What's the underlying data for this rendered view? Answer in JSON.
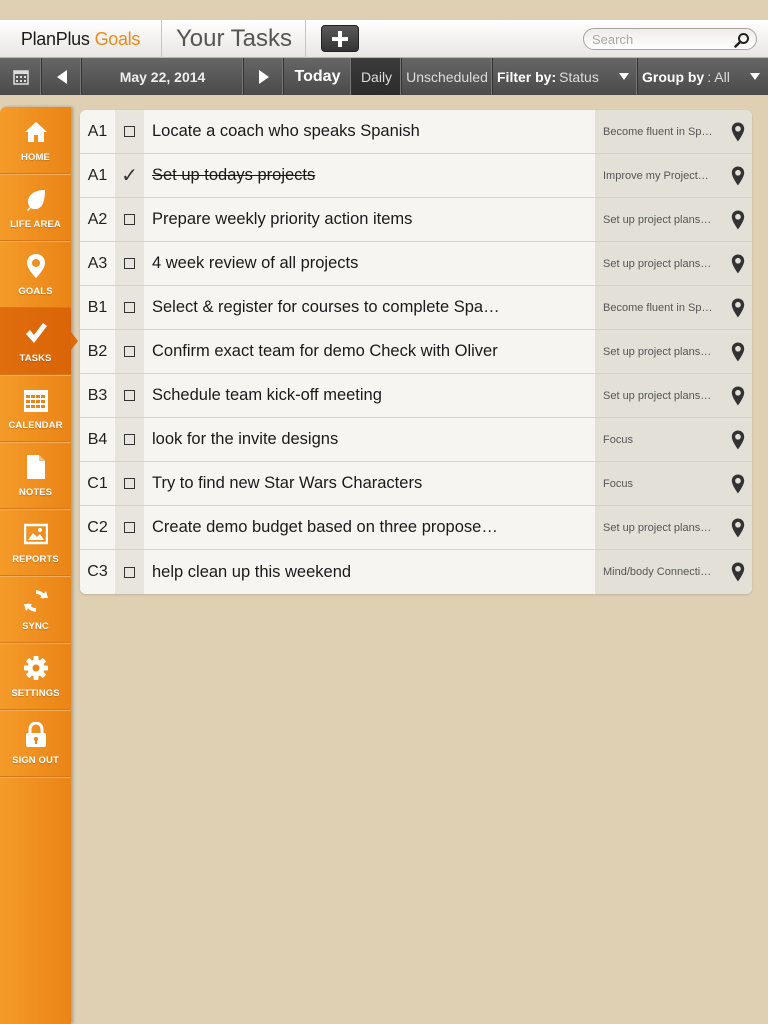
{
  "header": {
    "brand_main": "PlanPlus",
    "brand_accent": "Goals",
    "page_title": "Your Tasks",
    "search_placeholder": "Search"
  },
  "toolbar": {
    "date": "May 22, 2014",
    "today_label": "Today",
    "daily_label": "Daily",
    "unscheduled_label": "Unscheduled",
    "filter_label": "Filter by:",
    "filter_value": "Status",
    "group_label": "Group by",
    "group_value": ": All"
  },
  "sidebar": {
    "items": [
      {
        "label": "HOME",
        "icon": "home-icon"
      },
      {
        "label": "LIFE AREA",
        "icon": "leaf-icon"
      },
      {
        "label": "GOALS",
        "icon": "map-pin-icon"
      },
      {
        "label": "TASKS",
        "icon": "checkmark-icon",
        "active": true
      },
      {
        "label": "CALENDAR",
        "icon": "calendar-icon"
      },
      {
        "label": "NOTES",
        "icon": "document-icon"
      },
      {
        "label": "REPORTS",
        "icon": "image-icon"
      },
      {
        "label": "SYNC",
        "icon": "sync-icon"
      },
      {
        "label": "SETTINGS",
        "icon": "gear-icon"
      },
      {
        "label": "SIGN OUT",
        "icon": "lock-icon"
      }
    ]
  },
  "tasks": [
    {
      "priority": "A1",
      "done": false,
      "title": "Locate a coach who speaks Spanish",
      "goal": "Become fluent in Sp…"
    },
    {
      "priority": "A1",
      "done": true,
      "title": "Set up todays projects",
      "goal": "Improve my Project…"
    },
    {
      "priority": "A2",
      "done": false,
      "title": "Prepare weekly priority action items",
      "goal": "Set up project plans…"
    },
    {
      "priority": "A3",
      "done": false,
      "title": "4 week review of all projects",
      "goal": "Set up project plans…"
    },
    {
      "priority": "B1",
      "done": false,
      "title": "Select & register for courses to complete Spa…",
      "goal": "Become fluent in Sp…"
    },
    {
      "priority": "B2",
      "done": false,
      "title": "Confirm exact team for demo Check with Oliver",
      "goal": "Set up project plans…"
    },
    {
      "priority": "B3",
      "done": false,
      "title": "Schedule team kick-off meeting",
      "goal": "Set up project plans…"
    },
    {
      "priority": "B4",
      "done": false,
      "title": "look for the invite designs",
      "goal": "Focus"
    },
    {
      "priority": "C1",
      "done": false,
      "title": "Try to find new Star Wars Characters",
      "goal": "Focus"
    },
    {
      "priority": "C2",
      "done": false,
      "title": "Create demo budget based on three propose…",
      "goal": "Set up project plans…"
    },
    {
      "priority": "C3",
      "done": false,
      "title": "help clean up this weekend",
      "goal": "Mind/body Connecti…"
    }
  ],
  "colors": {
    "accent": "#ee8a1c",
    "sidebar": "#f49b2a",
    "background": "#dfd0b4"
  }
}
